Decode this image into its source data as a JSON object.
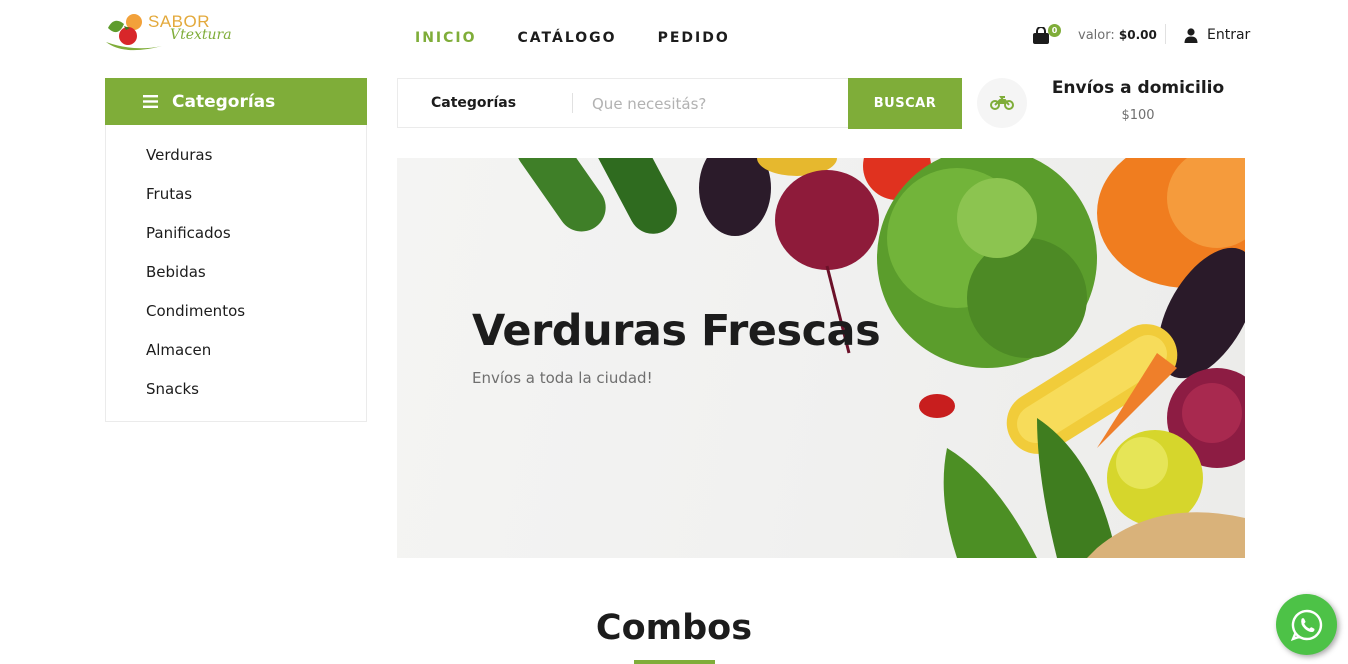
{
  "header": {
    "logo": {
      "line1": "SABOR",
      "line2": "Vtextura"
    },
    "nav": [
      {
        "label": "INICIO",
        "active": true
      },
      {
        "label": "CATÁLOGO",
        "active": false
      },
      {
        "label": "PEDIDO",
        "active": false
      }
    ],
    "cart": {
      "icon": "shopping-bag-icon",
      "count": "0",
      "value_label": "valor:",
      "value_amount": "$0.00"
    },
    "login": {
      "icon": "user-icon",
      "label": "Entrar"
    }
  },
  "sidebar": {
    "title": "Categorías",
    "icon": "menu-icon",
    "items": [
      {
        "label": "Verduras"
      },
      {
        "label": "Frutas"
      },
      {
        "label": "Panificados"
      },
      {
        "label": "Bebidas"
      },
      {
        "label": "Condimentos"
      },
      {
        "label": "Almacen"
      },
      {
        "label": "Snacks"
      }
    ]
  },
  "search": {
    "category_label": "Categorías",
    "placeholder": "Que necesitás?",
    "value": "",
    "button_label": "BUSCAR"
  },
  "delivery": {
    "icon": "motorcycle-icon",
    "title": "Envíos a domicilio",
    "price": "$100"
  },
  "hero": {
    "title": "Verduras Frescas",
    "subtitle": "Envíos a toda la ciudad!"
  },
  "section": {
    "title": "Combos"
  },
  "colors": {
    "accent": "#7fad39",
    "text": "#1c1c1c",
    "muted": "#6f6f6f",
    "whatsapp": "#4dc247"
  }
}
